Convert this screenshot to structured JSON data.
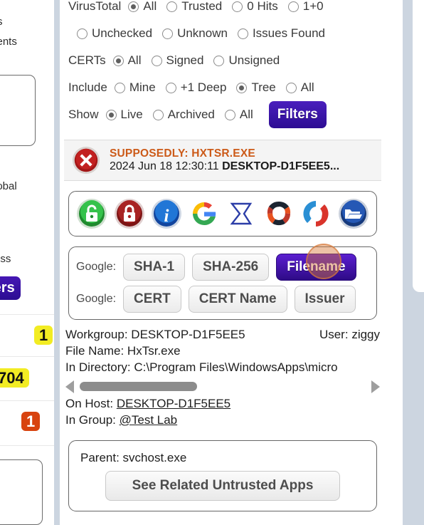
{
  "filters": {
    "rows": [
      {
        "label": "VirusTotal",
        "options": [
          {
            "label": "All",
            "selected": true
          },
          {
            "label": "Trusted",
            "selected": false
          },
          {
            "label": "0 Hits",
            "selected": false
          },
          {
            "label": "1+0",
            "selected": false
          }
        ]
      },
      {
        "label": "",
        "options": [
          {
            "label": "Unchecked",
            "selected": false
          },
          {
            "label": "Unknown",
            "selected": false
          },
          {
            "label": "Issues Found",
            "selected": false
          }
        ]
      },
      {
        "label": "CERTs",
        "options": [
          {
            "label": "All",
            "selected": true
          },
          {
            "label": "Signed",
            "selected": false
          },
          {
            "label": "Unsigned",
            "selected": false
          }
        ]
      },
      {
        "label": "Include",
        "options": [
          {
            "label": "Mine",
            "selected": false
          },
          {
            "label": "+1 Deep",
            "selected": false
          },
          {
            "label": "Tree",
            "selected": true
          },
          {
            "label": "All",
            "selected": false
          }
        ]
      },
      {
        "label": "Show",
        "options": [
          {
            "label": "Live",
            "selected": true
          },
          {
            "label": "Archived",
            "selected": false
          },
          {
            "label": "All",
            "selected": false
          }
        ]
      }
    ],
    "filters_button": "Filters"
  },
  "alert": {
    "icon": "error-x-icon",
    "title": "SUPPOSEDLY: HXTSR.EXE",
    "timestamp": "2024 Jun 18 12:30:11",
    "host": "DESKTOP-D1F5EE5..."
  },
  "icon_row": [
    {
      "name": "green-unlock-icon"
    },
    {
      "name": "red-lock-icon"
    },
    {
      "name": "blue-info-icon"
    },
    {
      "name": "google-g-icon"
    },
    {
      "name": "sigma-icon"
    },
    {
      "name": "virustotal-icon"
    },
    {
      "name": "sophos-s-icon"
    },
    {
      "name": "open-folder-icon"
    }
  ],
  "lookup": {
    "rows": [
      {
        "label": "Google:",
        "buttons": [
          {
            "label": "SHA-1",
            "primary": false
          },
          {
            "label": "SHA-256",
            "primary": false
          },
          {
            "label": "Filename",
            "primary": true
          }
        ]
      },
      {
        "label": "Google:",
        "buttons": [
          {
            "label": "CERT",
            "primary": false
          },
          {
            "label": "CERT Name",
            "primary": false
          },
          {
            "label": "Issuer",
            "primary": false
          }
        ]
      }
    ]
  },
  "details": {
    "workgroup_label": "Workgroup:",
    "workgroup_value": "DESKTOP-D1F5EE5",
    "user_label": "User:",
    "user_value": "ziggy",
    "filename_label": "File Name:",
    "filename_value": "HxTsr.exe",
    "directory_label": "In Directory:",
    "directory_value": "C:\\Program Files\\WindowsApps\\micro",
    "on_host_label": "On Host:",
    "on_host_value": "DESKTOP-D1F5EE5",
    "in_group_label": "In Group:",
    "in_group_value": "@Test Lab"
  },
  "parent": {
    "label": "Parent: svchost.exe",
    "related_button": "See Related Untrusted Apps"
  },
  "background_left": {
    "text_fragments": [
      "s",
      "vents",
      "lobal",
      "ess"
    ],
    "filters_button_fragment": "ters",
    "badges": [
      {
        "value": "1",
        "color": "#f2ec23"
      },
      {
        "value": "704",
        "color": "#f2ec23"
      },
      {
        "value": "1",
        "color": "#d8430f"
      }
    ]
  },
  "colors": {
    "accent_purple": "#3a12a8",
    "alert_orange": "#cc5a18",
    "badge_yellow": "#f2ec23",
    "badge_orange": "#d8430f",
    "panel_gray": "#ccd5e0"
  }
}
